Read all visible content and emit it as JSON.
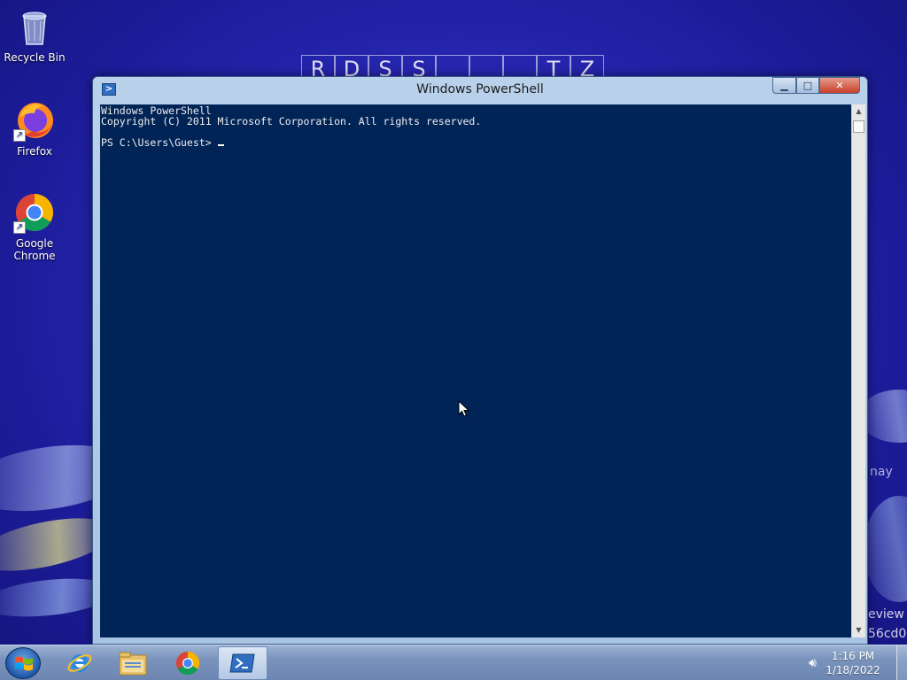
{
  "desktop": {
    "background_letters": [
      "R",
      "D",
      "S",
      "S",
      "",
      "",
      "",
      "T",
      "Z"
    ],
    "watermark_lines": [
      "nay",
      "eview",
      "56cd0"
    ],
    "icons": [
      {
        "label": "Recycle Bin",
        "icon": "recycle-bin-icon"
      },
      {
        "label": "Firefox",
        "icon": "firefox-icon"
      },
      {
        "label": "Google Chrome",
        "icon": "chrome-icon"
      }
    ]
  },
  "window": {
    "title": "Windows PowerShell",
    "icon": "powershell-icon",
    "controls": {
      "minimize": "minimize",
      "maximize": "maximize",
      "close": "close"
    },
    "console": {
      "background_color": "#012456",
      "lines": [
        "Windows PowerShell",
        "Copyright (C) 2011 Microsoft Corporation. All rights reserved.",
        "",
        "PS C:\\Users\\Guest> "
      ]
    }
  },
  "taskbar": {
    "start": "start-button",
    "pinned": [
      {
        "name": "Internet Explorer",
        "icon": "internet-explorer-icon",
        "active": false
      },
      {
        "name": "Windows Explorer",
        "icon": "folder-icon",
        "active": false
      },
      {
        "name": "Google Chrome",
        "icon": "chrome-icon",
        "active": false
      },
      {
        "name": "Windows PowerShell",
        "icon": "powershell-icon",
        "active": true
      }
    ],
    "tray": {
      "volume_icon": "volume-icon",
      "time": "1:16 PM",
      "date": "1/18/2022"
    }
  }
}
